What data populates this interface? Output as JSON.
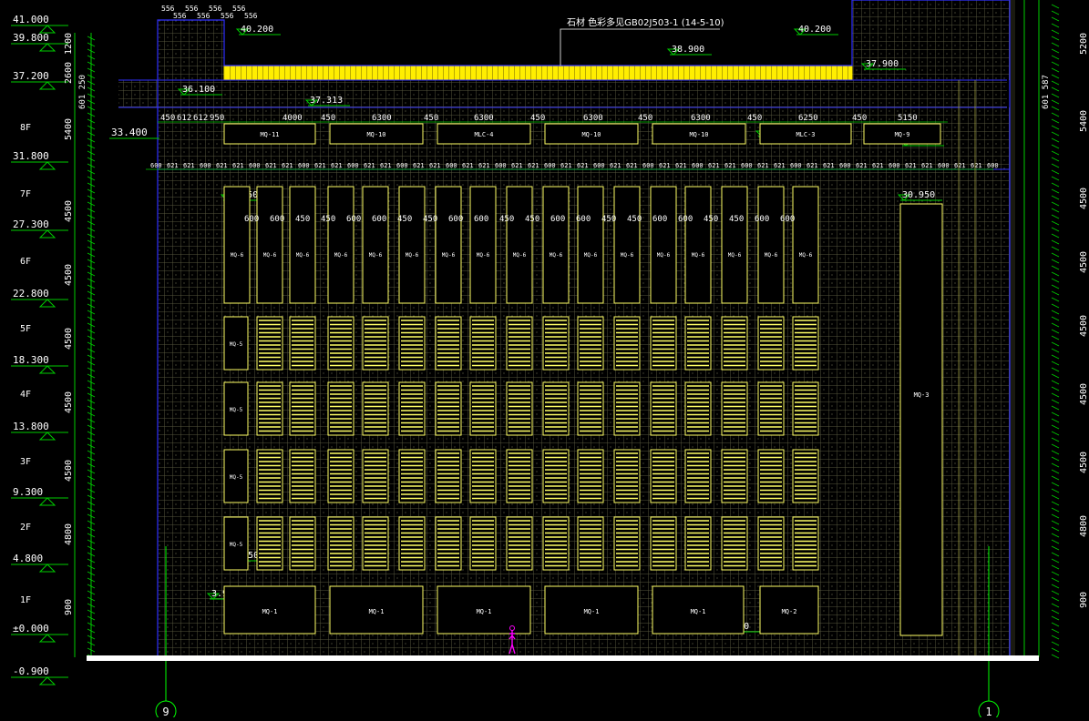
{
  "drawing": {
    "note_title": "石材 色彩多见GB02J503-1 (14-5-10)",
    "colors": {
      "background": "#000000",
      "facade_grid": "#6b6b4a",
      "window_frame": "#ffff66",
      "dimension": "#00cc00",
      "text": "#ffffff",
      "roof_highlight": "#ffee00",
      "axis": "#00ff00",
      "outline": "#3030ff",
      "accent": "#ff00ff"
    },
    "levels": [
      {
        "label": "41.000"
      },
      {
        "label": "39.800"
      },
      {
        "label": "37.200"
      },
      {
        "label": "8F"
      },
      {
        "label": "33.400"
      },
      {
        "label": "31.800"
      },
      {
        "label": "7F"
      },
      {
        "label": "27.300"
      },
      {
        "label": "6F"
      },
      {
        "label": "22.800"
      },
      {
        "label": "5F"
      },
      {
        "label": "18.300"
      },
      {
        "label": "4F"
      },
      {
        "label": "13.800"
      },
      {
        "label": "3F"
      },
      {
        "label": "9.300"
      },
      {
        "label": "2F"
      },
      {
        "label": "4.800"
      },
      {
        "label": "1F"
      },
      {
        "label": "±0.000"
      },
      {
        "label": "-0.900"
      }
    ],
    "left_heights": [
      "1200",
      "2600",
      "5400",
      "4500",
      "4500",
      "4500",
      "4500",
      "4500",
      "4800",
      "900"
    ],
    "right_heights": [
      "5200",
      "5400",
      "4500",
      "4500",
      "4500",
      "4500",
      "4500",
      "4800",
      "900"
    ],
    "elevation_marks": [
      "40.200",
      "40.200",
      "38.900",
      "37.900",
      "36.100",
      "37.313",
      "33.400",
      "33.400",
      "32.450",
      "30.950",
      "30.950",
      "4.850",
      "3.950",
      "0.450"
    ],
    "top_dims": [
      "556",
      "556",
      "556",
      "556",
      "556",
      "556",
      "556",
      "556"
    ],
    "row8_dims": [
      "450",
      "612",
      "612",
      "950",
      "4000",
      "450",
      "6300",
      "450",
      "6300",
      "450",
      "6300",
      "450",
      "6300",
      "450",
      "6250",
      "450",
      "5150"
    ],
    "row7_dims": [
      "600",
      "600",
      "450",
      "450",
      "600",
      "600",
      "450",
      "450",
      "600",
      "600",
      "450",
      "450",
      "600",
      "600",
      "450",
      "450",
      "600",
      "600",
      "450",
      "450",
      "600",
      "600"
    ],
    "window_tags": {
      "row8": [
        "MQ-11",
        "MQ-10",
        "MLC-4",
        "MQ-10",
        "MQ-10",
        "MLC-3",
        "MQ-9"
      ],
      "tall": "MQ-6",
      "side": "MQ-5",
      "right": "MQ-3",
      "ground": [
        "MQ-1",
        "MQ-1",
        "MQ-1",
        "MQ-1",
        "MQ-1",
        "MQ-2"
      ]
    },
    "axis_labels": [
      "9",
      "1"
    ],
    "side_dims_left": "601 250",
    "side_dims_right": "601 587"
  }
}
